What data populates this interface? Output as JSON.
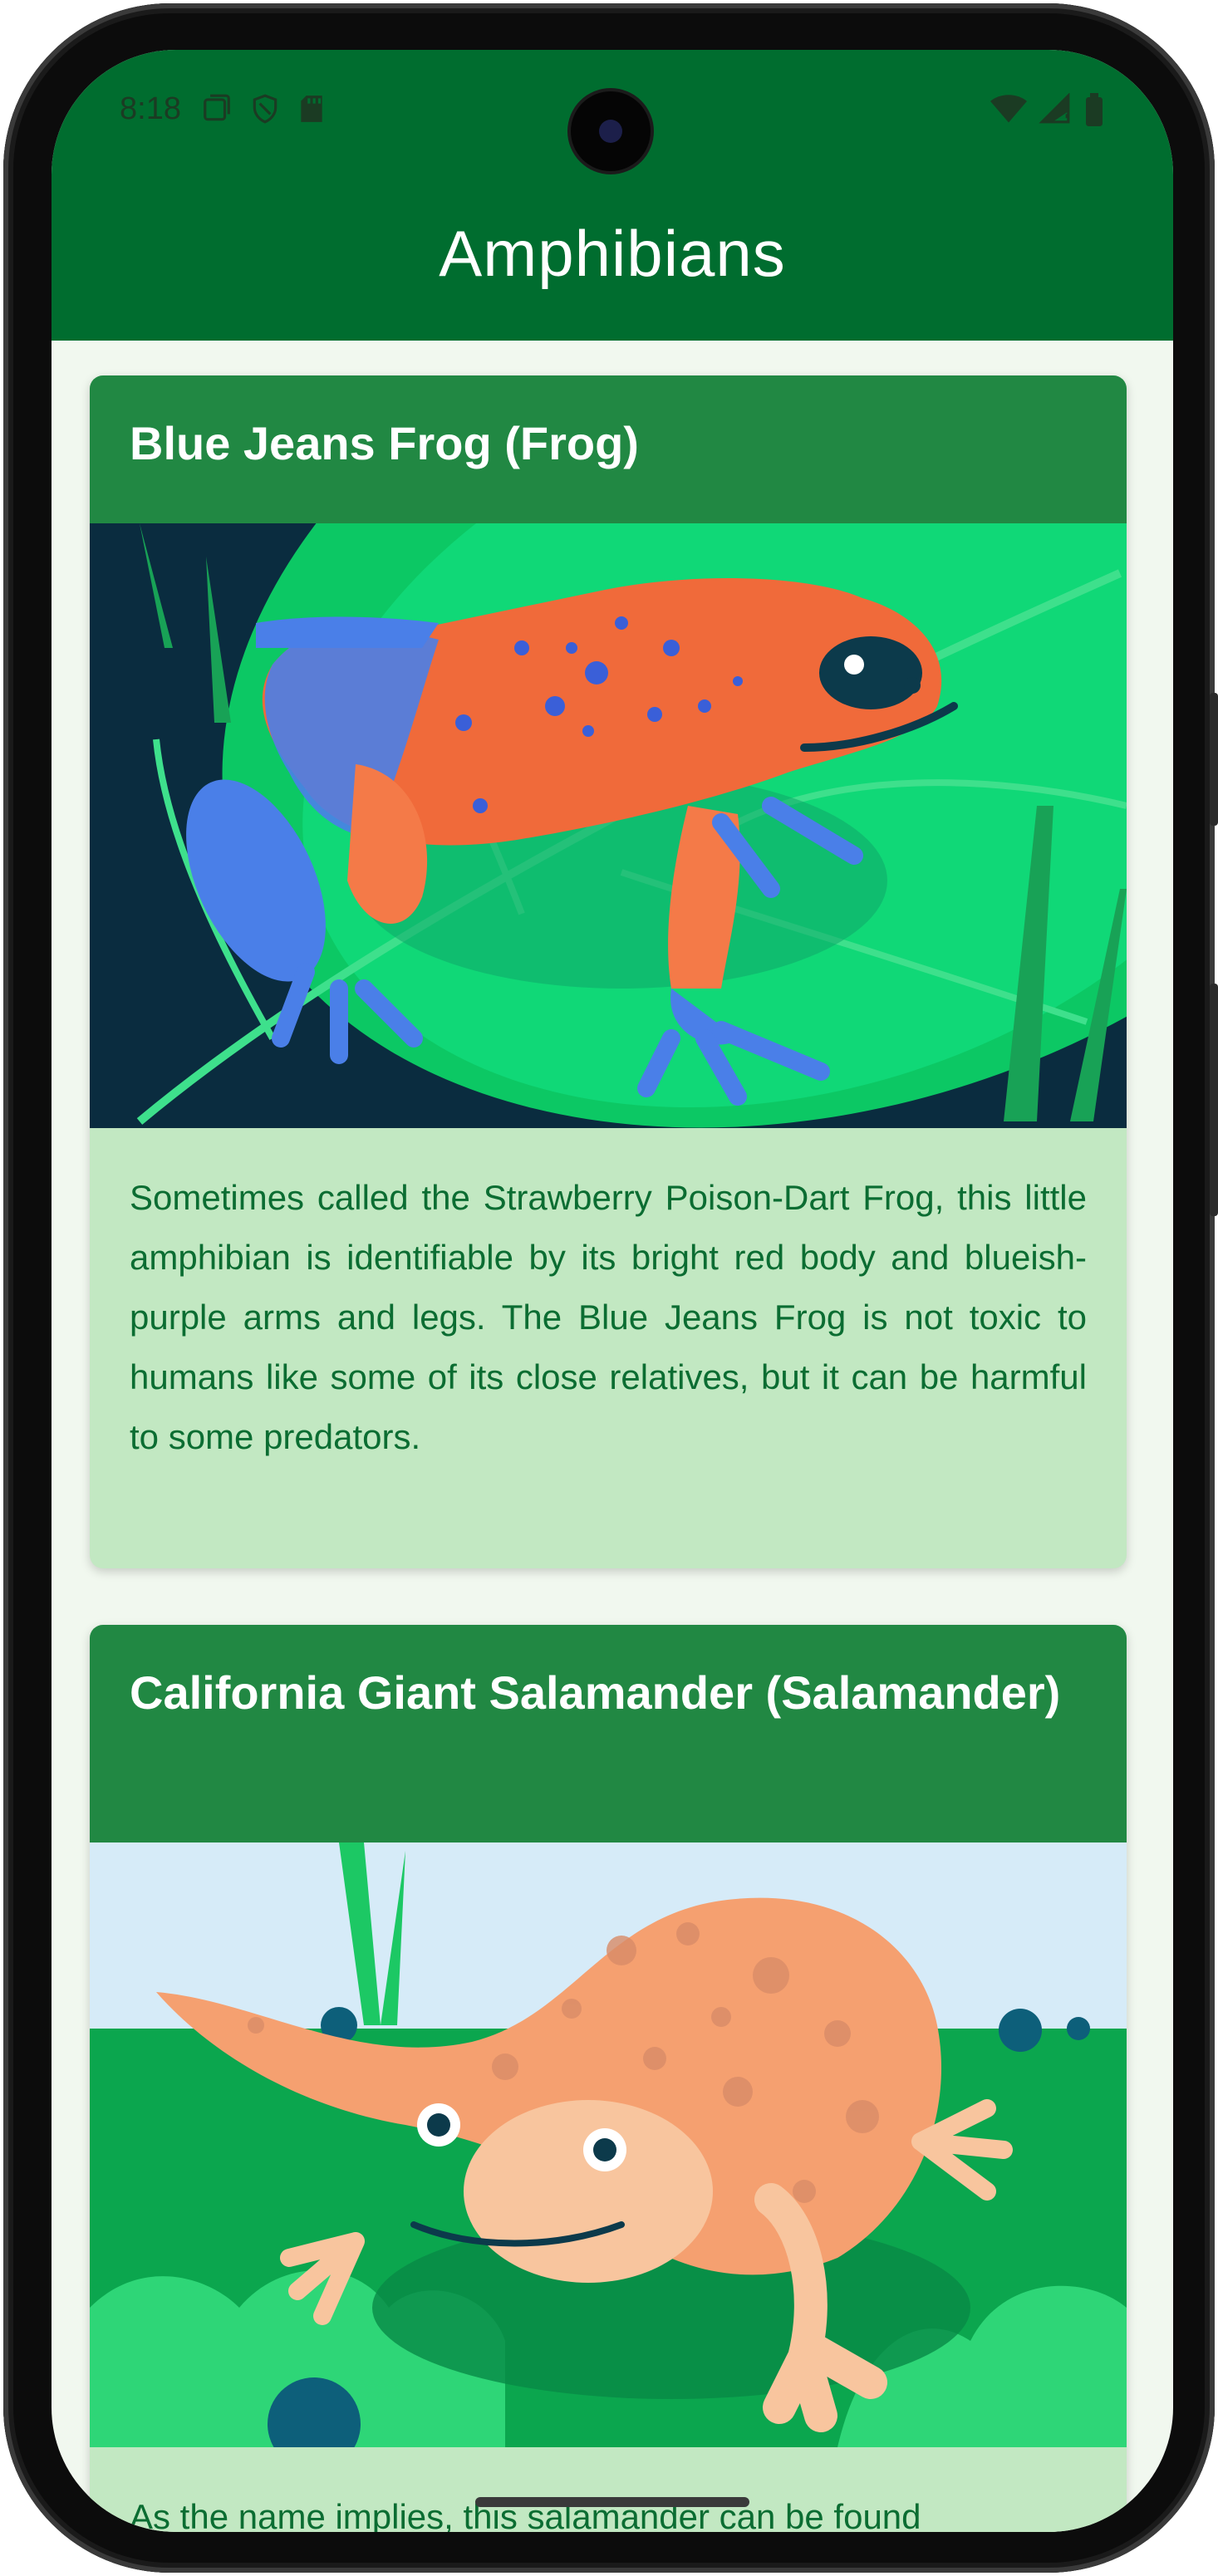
{
  "status_bar": {
    "time": "8:18"
  },
  "app_bar": {
    "title": "Amphibians"
  },
  "cards": [
    {
      "title": "Blue Jeans Frog (Frog)",
      "image_icon": "blue-jeans-frog-illustration",
      "description": "Sometimes called the Strawberry Poison-Dart Frog, this little amphibian is identifiable by its bright red body and blueish-purple arms and legs. The Blue Jeans Frog is not toxic to humans like some of its close relatives, but it can be harmful to some predators."
    },
    {
      "title": "California Giant Salamander (Salamander)",
      "image_icon": "california-giant-salamander-illustration",
      "description": "As the name implies, this salamander can be found"
    }
  ],
  "colors": {
    "app_bar": "#006d2f",
    "card_header": "#218843",
    "card_body": "#c2e8c2",
    "body_text": "#0b6d32",
    "background": "#f1f8ef"
  }
}
